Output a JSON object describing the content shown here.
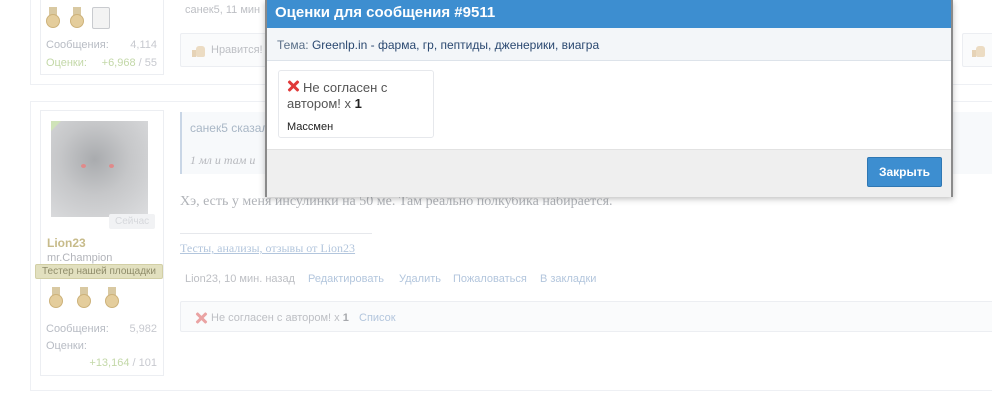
{
  "top_post": {
    "stats": {
      "messages_label": "Сообщения:",
      "messages_value": "4,114",
      "ratings_label": "Оценки:",
      "ratings_positive": "+6,968",
      "ratings_rest": " / 55"
    },
    "author_line": "санек5, 11 мин",
    "like_label": "Нравится!"
  },
  "second_post": {
    "user": {
      "name": "Lion23",
      "title": "mr.Champion",
      "rank": "Тестер нашей площадки",
      "online_badge": "Сейчас",
      "messages_label": "Сообщения:",
      "messages_value": "5,982",
      "ratings_label": "Оценки:",
      "ratings_positive": "+13,164",
      "ratings_rest": " / 101"
    },
    "quote_author": "санек5 сказал",
    "quote_text": "1 мл и там и",
    "message": "Хэ, есть у меня инсулинки на 50 ме. Там реально полкубика набирается.",
    "signature_link": "Тесты, анализы, отзывы от Lion23",
    "meta": {
      "author_time": "Lion23, 10 мин. назад",
      "edit": "Редактировать",
      "delete": "Удалить",
      "report": "Пожаловаться",
      "bookmark": "В закладки"
    },
    "rating_summary": {
      "text": "Не согласен с автором!",
      "times": "x",
      "count": "1",
      "list_link": "Список"
    }
  },
  "modal": {
    "title": "Оценки для сообщения #9511",
    "topic_label": "Тема:",
    "topic_value": "Greenlp.in - фарма, гр, пептиды, дженерики, виагра",
    "rating": {
      "label": "Не согласен с автором!",
      "times": "x",
      "count": "1",
      "user": "Массмен"
    },
    "close_button": "Закрыть"
  },
  "colors": {
    "header_blue": "#3d8ed0",
    "negative_red": "#e03a3a",
    "positive_green": "#8ab85a"
  }
}
